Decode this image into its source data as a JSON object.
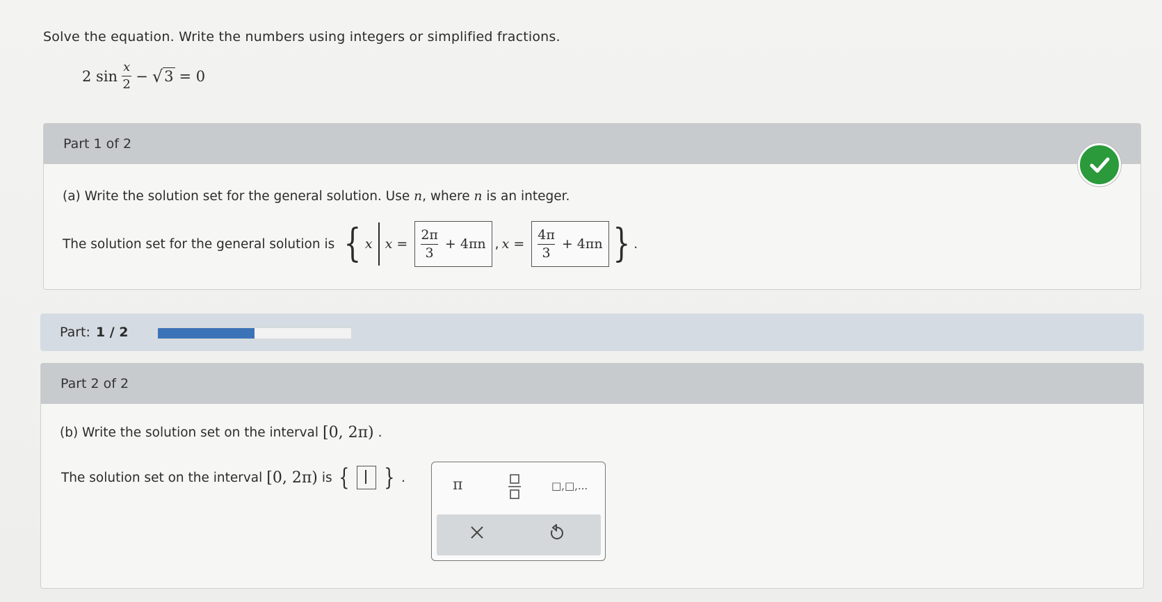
{
  "problem": {
    "prompt": "Solve the equation. Write the numbers using integers or simplified fractions.",
    "equation": {
      "coef": "2 sin",
      "frac_num": "x",
      "frac_den": "2",
      "minus": "−",
      "radicand": "3",
      "rhs": "= 0"
    }
  },
  "part1": {
    "header": "Part 1 of 2",
    "question_prefix": "(a) Write the solution set for the general solution. Use",
    "var_n": "n",
    "question_mid": ", where",
    "question_suffix": "is an integer.",
    "answer_label": "The solution set for the general solution is",
    "set_var": "x",
    "eq1": "x =",
    "ans1": {
      "num": "2π",
      "den": "3",
      "tail": "+ 4πn"
    },
    "comma": ",",
    "eq2": "x =",
    "ans2": {
      "num": "4π",
      "den": "3",
      "tail": "+ 4πn"
    },
    "status_icon": "check-icon",
    "status_color": "#2a9a3a"
  },
  "progress": {
    "label": "Part:",
    "value_text": "1 / 2",
    "fraction": 0.5,
    "fill_color": "#3c73b8"
  },
  "part2": {
    "header": "Part 2 of 2",
    "question_prefix": "(b) Write the solution set on the interval",
    "interval": "[0, 2π)",
    "period": ".",
    "answer_prefix": "The solution set on the interval",
    "answer_mid": "is",
    "palette": {
      "pi_button": "π",
      "fraction_icon": "fraction-icon",
      "list_icon": "list-icon",
      "list_text": "□,□,...",
      "clear_icon": "clear-icon",
      "undo_icon": "undo-icon"
    }
  }
}
